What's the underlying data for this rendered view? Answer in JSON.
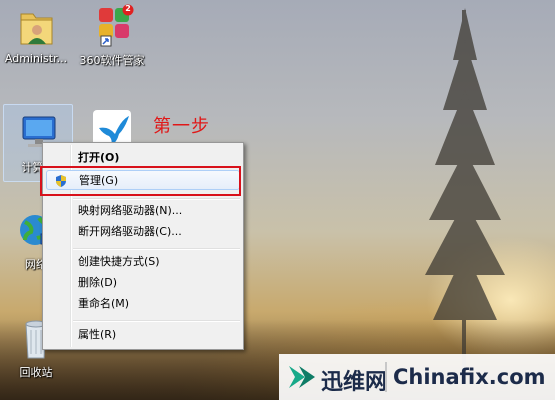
{
  "desktop": {
    "icons": [
      {
        "id": "admin",
        "label": "Administr..."
      },
      {
        "id": "mgr360",
        "label": "360软件管家",
        "badge": "2"
      },
      {
        "id": "computer",
        "label": "计算机"
      },
      {
        "id": "xunlei",
        "label": ""
      },
      {
        "id": "network",
        "label": "网络"
      },
      {
        "id": "recycle",
        "label": "回收站"
      }
    ],
    "annotation": "第一步"
  },
  "context_menu": {
    "items": [
      {
        "label": "打开(O)",
        "bold": true
      },
      {
        "label": "管理(G)",
        "highlighted": true,
        "icon": "uac-shield-icon"
      },
      {
        "label": "映射网络驱动器(N)..."
      },
      {
        "label": "断开网络驱动器(C)..."
      },
      {
        "label": "创建快捷方式(S)"
      },
      {
        "label": "删除(D)"
      },
      {
        "label": "重命名(M)"
      },
      {
        "label": "属性(R)"
      }
    ]
  },
  "watermark": {
    "cn": "迅维网",
    "en": "Chinafix.com"
  },
  "colors": {
    "annotation": "#e01818",
    "highlight_box": "#d8101a",
    "watermark_text": "#1c2b4a",
    "watermark_logo": "#17a989"
  }
}
